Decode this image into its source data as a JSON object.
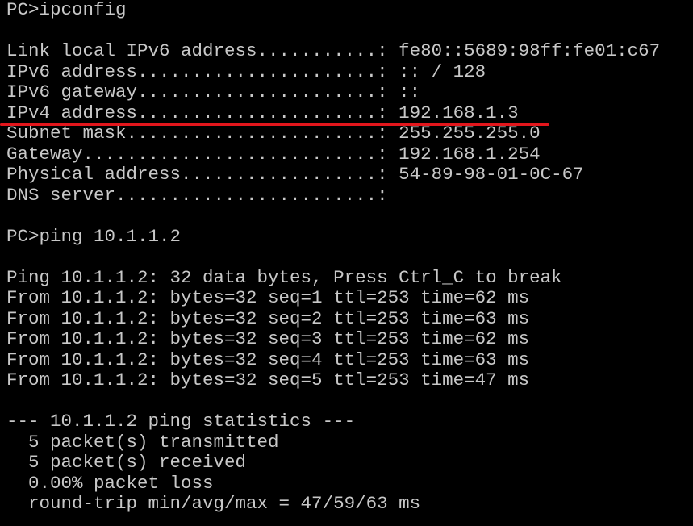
{
  "terminal": {
    "lines": [
      "PC>ipconfig",
      "",
      "Link local IPv6 address...........: fe80::5689:98ff:fe01:c67",
      "IPv6 address......................: :: / 128",
      "IPv6 gateway......................: ::",
      "IPv4 address......................: 192.168.1.3",
      "Subnet mask.......................: 255.255.255.0",
      "Gateway...........................: 192.168.1.254",
      "Physical address..................: 54-89-98-01-0C-67",
      "DNS server........................:",
      "",
      "PC>ping 10.1.1.2",
      "",
      "Ping 10.1.1.2: 32 data bytes, Press Ctrl_C to break",
      "From 10.1.1.2: bytes=32 seq=1 ttl=253 time=62 ms",
      "From 10.1.1.2: bytes=32 seq=2 ttl=253 time=63 ms",
      "From 10.1.1.2: bytes=32 seq=3 ttl=253 time=62 ms",
      "From 10.1.1.2: bytes=32 seq=4 ttl=253 time=63 ms",
      "From 10.1.1.2: bytes=32 seq=5 ttl=253 time=47 ms",
      "",
      "--- 10.1.1.2 ping statistics ---",
      "  5 packet(s) transmitted",
      "  5 packet(s) received",
      "  0.00% packet loss",
      "  round-trip min/avg/max = 47/59/63 ms"
    ]
  },
  "colors": {
    "background": "#000000",
    "text": "#c8c8c8",
    "annotation": "#e3161c"
  }
}
